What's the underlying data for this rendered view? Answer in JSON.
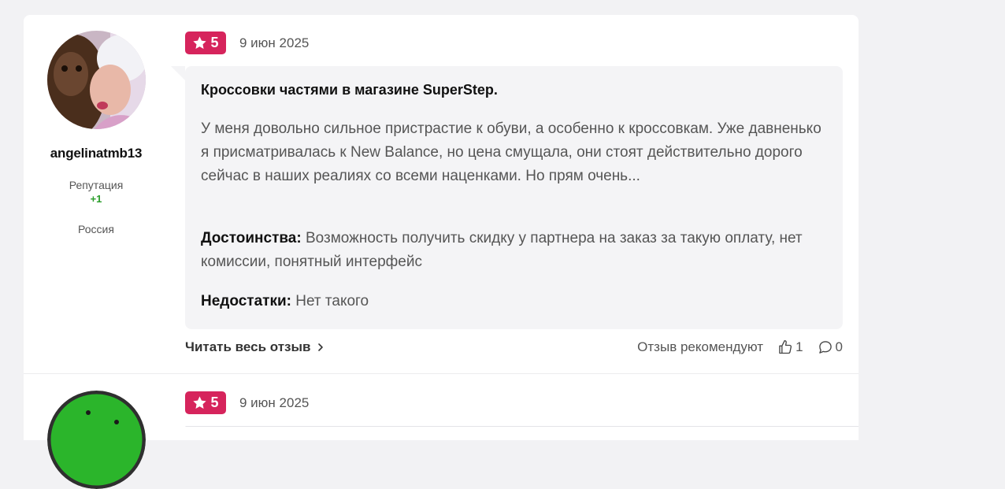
{
  "reviews": [
    {
      "author": {
        "username": "angelinatmb13",
        "reputation_label": "Репутация",
        "reputation_value": "+1",
        "country": "Россия"
      },
      "rating": "5",
      "date": "9 июн 2025",
      "title": "Кроссовки частями в магазине SuperStep.",
      "text": "У меня довольно сильное пристрастие к обуви, а особенно к кроссовкам. Уже давненько я присматривалась к New Balance, но цена смущала, они стоят действительно дорого сейчас в наших реалиях со всеми наценками. Но прям очень...",
      "pros_label": "Достоинства:",
      "pros": "Возможность получить скидку у партнера на заказ за такую оплату, нет комиссии, понятный интерфейс",
      "cons_label": "Недостатки:",
      "cons": "Нет такого",
      "read_more": "Читать весь отзыв",
      "recommend": "Отзыв рекомендуют",
      "likes": "1",
      "comments": "0"
    },
    {
      "rating": "5",
      "date": "9 июн 2025"
    }
  ],
  "colors": {
    "rating_badge": "#d6245c",
    "reputation": "#2a9d2a"
  },
  "icons": [
    "star-icon",
    "chevron-right-icon",
    "thumbs-up-icon",
    "comment-icon"
  ]
}
